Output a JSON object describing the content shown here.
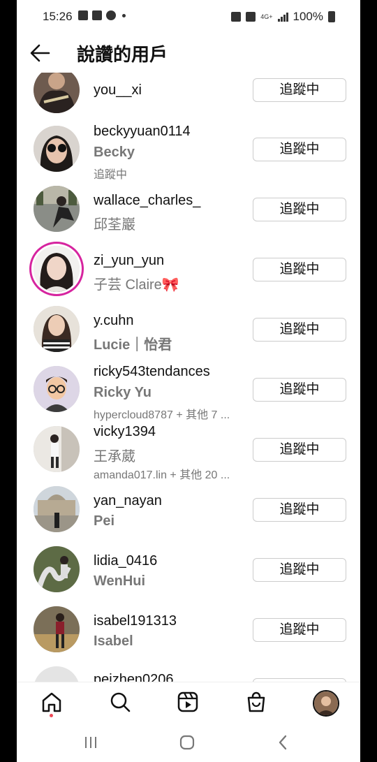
{
  "status_bar": {
    "time": "15:26",
    "network": "4G+",
    "battery": "100%"
  },
  "header": {
    "title": "說讚的用戶"
  },
  "follow_button_label": "追蹤中",
  "users": [
    {
      "username": "you__xi",
      "name": "",
      "subtitle": ""
    },
    {
      "username": "beckyyuan0114",
      "name": "Becky",
      "subtitle": "追蹤中"
    },
    {
      "username": "wallace_charles_",
      "name": "邱荃巖",
      "subtitle": ""
    },
    {
      "username": "zi_yun_yun",
      "name": "子芸 Claire🎀",
      "subtitle": ""
    },
    {
      "username": "y.cuhn",
      "name": "Lucie｜怡君",
      "subtitle": ""
    },
    {
      "username": "ricky543tendances",
      "name": "Ricky Yu",
      "subtitle": "hypercloud8787 + 其他 7 ..."
    },
    {
      "username": "vicky1394",
      "name": "王承葳",
      "subtitle": "amanda017.lin + 其他 20 ..."
    },
    {
      "username": "yan_nayan",
      "name": "Pei",
      "subtitle": ""
    },
    {
      "username": "lidia_0416",
      "name": "WenHui",
      "subtitle": ""
    },
    {
      "username": "isabel191313",
      "name": "Isabel",
      "subtitle": ""
    },
    {
      "username": "peizhen0206",
      "name": "",
      "subtitle": ""
    }
  ],
  "bottom_nav": [
    "home-icon",
    "search-icon",
    "reels-icon",
    "shop-icon",
    "profile-avatar"
  ],
  "colors": {
    "story_ring": "#d6249f",
    "notification_dot": "#ed4956"
  }
}
